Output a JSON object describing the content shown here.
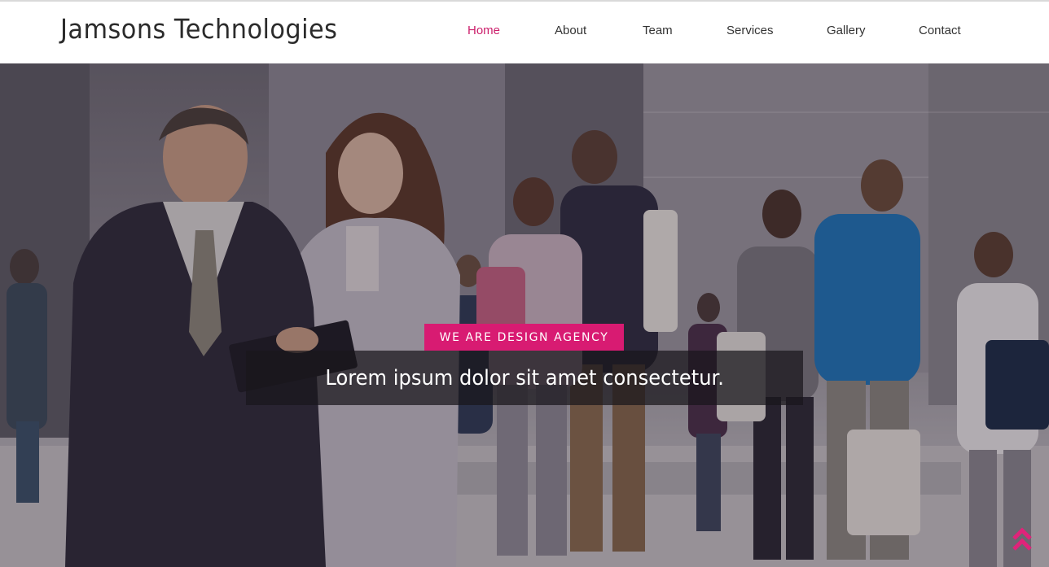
{
  "brand": {
    "name": "Jamsons Technologies"
  },
  "nav": {
    "items": [
      {
        "label": "Home",
        "active": true
      },
      {
        "label": "About",
        "active": false
      },
      {
        "label": "Team",
        "active": false
      },
      {
        "label": "Services",
        "active": false
      },
      {
        "label": "Gallery",
        "active": false
      },
      {
        "label": "Contact",
        "active": false
      }
    ]
  },
  "hero": {
    "tag": "WE ARE DESIGN AGENCY",
    "headline": "Lorem ipsum dolor sit amet consectetur.",
    "background_icon": "business-people-photo"
  },
  "scroll_top": {
    "icon": "double-chevron-up-icon"
  },
  "colors": {
    "accent": "#d81b72",
    "nav_active": "#cc1f6b",
    "nav_text": "#333333",
    "brand_text": "#2b2b2b",
    "headline_box": "#19161c"
  }
}
